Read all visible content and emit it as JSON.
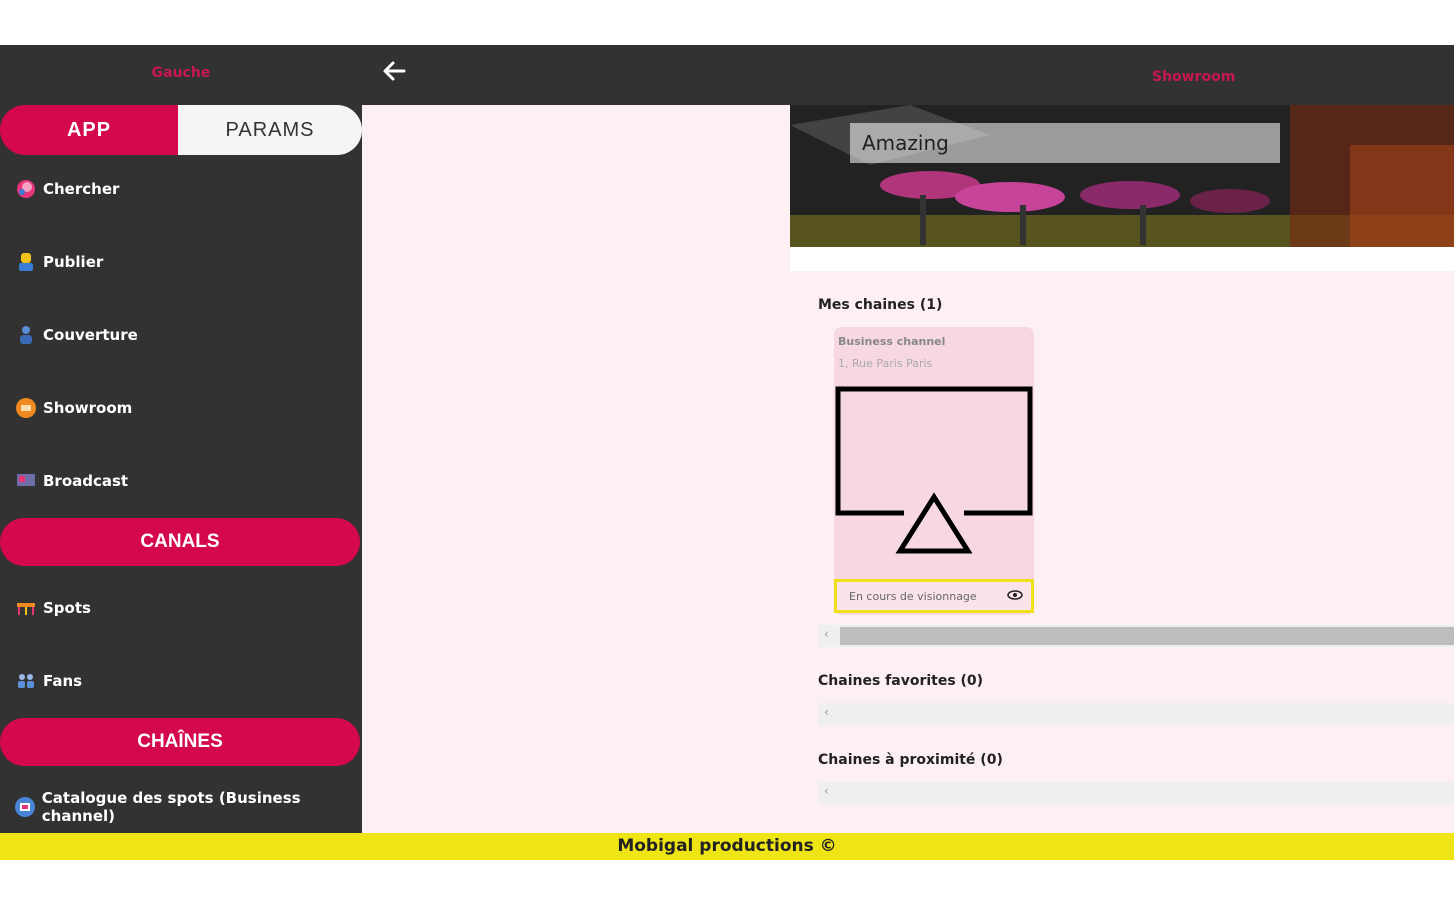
{
  "sidebar": {
    "title": "Gauche",
    "tabs": {
      "app": "APP",
      "params": "PARAMS"
    },
    "items": [
      {
        "label": "Chercher",
        "icon": "search-icon"
      },
      {
        "label": "Publier",
        "icon": "publish-icon"
      },
      {
        "label": "Couverture",
        "icon": "coverage-icon"
      },
      {
        "label": "Showroom",
        "icon": "showroom-icon"
      },
      {
        "label": "Broadcast",
        "icon": "broadcast-icon"
      }
    ],
    "section_canals": "CANALS",
    "canal_items": [
      {
        "label": "Spots",
        "icon": "spots-icon"
      },
      {
        "label": "Fans",
        "icon": "fans-icon"
      }
    ],
    "section_chaines": "CHAÎNES",
    "chaine_items": [
      {
        "label": "Catalogue des spots (Business channel)",
        "icon": "catalog-icon"
      }
    ]
  },
  "header": {
    "title": "Showroom"
  },
  "banner": {
    "label": "Amazing"
  },
  "main": {
    "mes_chaines": "Mes chaines (1)",
    "card": {
      "name": "Business channel",
      "address": "1, Rue Paris  Paris",
      "status": "En cours de visionnage"
    },
    "favorites": "Chaines favorites (0)",
    "nearby": "Chaines à proximité (0)"
  },
  "footer": {
    "text": "Mobigal productions ©"
  },
  "colors": {
    "accent": "#d4084f",
    "dark": "#323232",
    "footer": "#efe515",
    "background": "#fdf0f3"
  }
}
